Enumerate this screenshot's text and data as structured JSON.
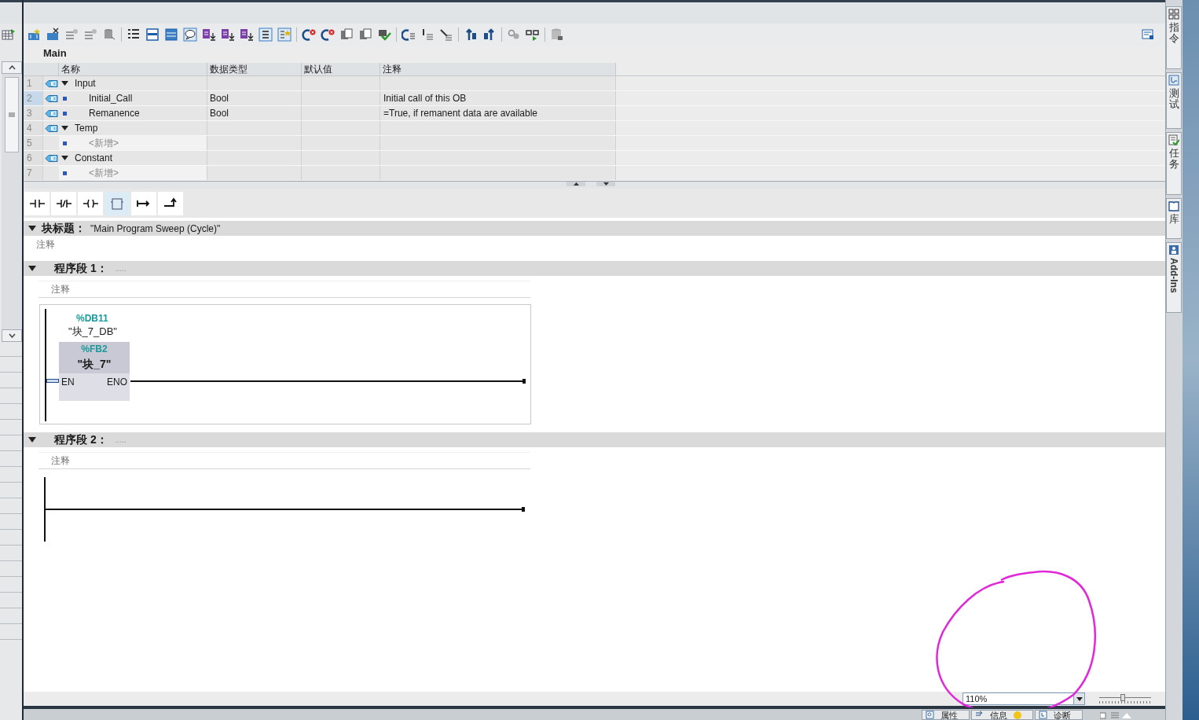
{
  "block_interface": {
    "title": "Main",
    "columns": [
      "名称",
      "数据类型",
      "默认值",
      "注释"
    ],
    "rows": [
      {
        "number": "1",
        "kind": "section",
        "name": "Input",
        "expanded": true,
        "selected": false
      },
      {
        "number": "2",
        "kind": "variable",
        "name": "Initial_Call",
        "data_type": "Bool",
        "comment": "Initial call of this OB",
        "selected": true
      },
      {
        "number": "3",
        "kind": "variable",
        "name": "Remanence",
        "data_type": "Bool",
        "comment": "=True, if remanent data are available",
        "selected": false
      },
      {
        "number": "4",
        "kind": "section",
        "name": "Temp",
        "expanded": true,
        "selected": false
      },
      {
        "number": "5",
        "kind": "placeholder",
        "name": "<新增>",
        "selected": false
      },
      {
        "number": "6",
        "kind": "section",
        "name": "Constant",
        "expanded": true,
        "selected": false
      },
      {
        "number": "7",
        "kind": "placeholder",
        "name": "<新增>",
        "selected": false
      }
    ]
  },
  "block_title": {
    "label": "块标题：",
    "value": "\"Main Program Sweep (Cycle)\"",
    "comment": "注释",
    "expanded": true
  },
  "networks": [
    {
      "label": "程序段 1：",
      "title": ".....",
      "comment": "注释",
      "expanded": true,
      "call": {
        "instance_address": "%DB11",
        "instance_name": "\"块_7_DB\"",
        "block_address": "%FB2",
        "block_name": "\"块_7\"",
        "input": "EN",
        "output": "ENO"
      }
    },
    {
      "label": "程序段 2：",
      "title": ".....",
      "comment": "注释",
      "expanded": true
    }
  ],
  "zoom": {
    "value": "110%",
    "level": 0.45
  },
  "task_cards": [
    {
      "label": "指令",
      "kind": "stacked"
    },
    {
      "label": "测试",
      "kind": "stacked"
    },
    {
      "label": "任务",
      "kind": "stacked"
    },
    {
      "label": "库",
      "kind": "stacked"
    },
    {
      "label": "Add-Ins",
      "kind": "rotated"
    }
  ],
  "bottom_tabs": [
    {
      "label": "属性"
    },
    {
      "label": "信息"
    },
    {
      "label": "诊断"
    }
  ]
}
